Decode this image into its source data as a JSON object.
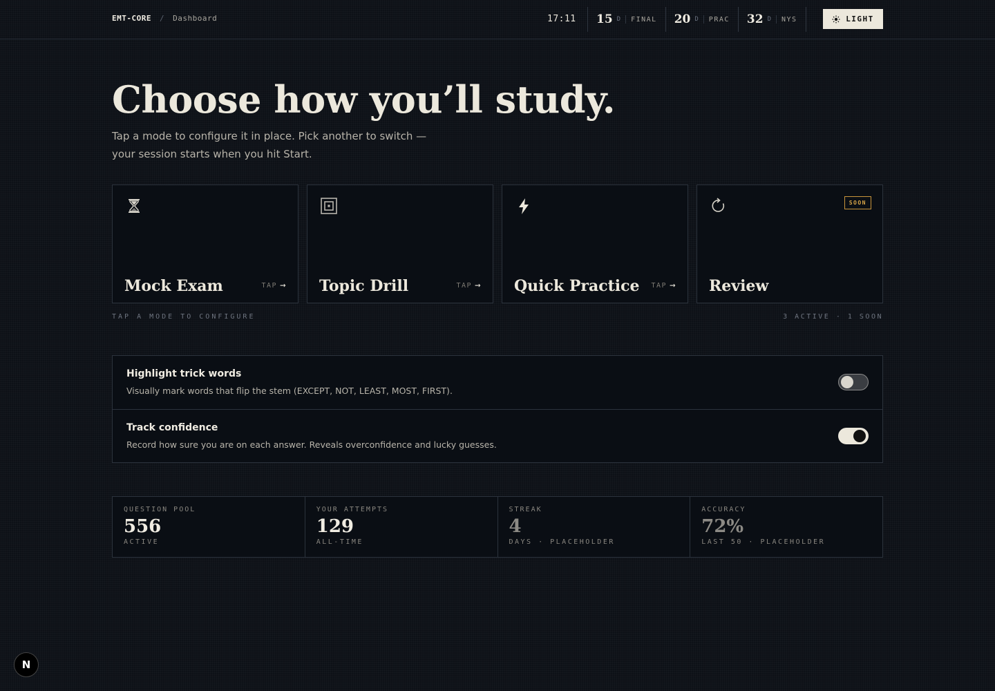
{
  "header": {
    "brand": "EMT-CORE",
    "separator": "/",
    "page": "Dashboard",
    "clock": "17:11",
    "countdowns": [
      {
        "value": "15",
        "unit": "D",
        "label": "FINAL"
      },
      {
        "value": "20",
        "unit": "D",
        "label": "PRAC"
      },
      {
        "value": "32",
        "unit": "D",
        "label": "NYS"
      }
    ],
    "theme_button": {
      "label": "LIGHT",
      "icon": "sun-icon"
    }
  },
  "hero": {
    "title": "Choose how you’ll study.",
    "subtitle": "Tap a mode to configure it in place. Pick another to switch — your session starts when you hit Start."
  },
  "modes": [
    {
      "title": "Mock Exam",
      "icon": "hourglass-icon",
      "tap": "TAP",
      "arrow": "→"
    },
    {
      "title": "Topic Drill",
      "icon": "target-square-icon",
      "tap": "TAP",
      "arrow": "→"
    },
    {
      "title": "Quick Practice",
      "icon": "lightning-icon",
      "tap": "TAP",
      "arrow": "→"
    },
    {
      "title": "Review",
      "icon": "refresh-icon",
      "badge": "SOON"
    }
  ],
  "modes_note": {
    "left": "TAP A MODE TO CONFIGURE",
    "right": "3 ACTIVE · 1 SOON"
  },
  "settings": [
    {
      "title": "Highlight trick words",
      "desc": "Visually mark words that flip the stem (EXCEPT, NOT, LEAST, MOST, FIRST).",
      "enabled": false
    },
    {
      "title": "Track confidence",
      "desc": "Record how sure you are on each answer. Reveals overconfidence and lucky guesses.",
      "enabled": true
    }
  ],
  "stats": [
    {
      "label": "QUESTION POOL",
      "value": "556",
      "sub": "ACTIVE"
    },
    {
      "label": "YOUR ATTEMPTS",
      "value": "129",
      "sub": "ALL-TIME"
    },
    {
      "label": "STREAK",
      "value": "4",
      "sub": "DAYS · PLACEHOLDER"
    },
    {
      "label": "ACCURACY",
      "value": "72%",
      "sub": "LAST 50 · PLACEHOLDER"
    }
  ],
  "fab": {
    "label": "N"
  },
  "colors": {
    "accent_soon": "#d9a648",
    "background": "#0d1117",
    "card": "#0a0e14",
    "text": "#ece8dc"
  }
}
